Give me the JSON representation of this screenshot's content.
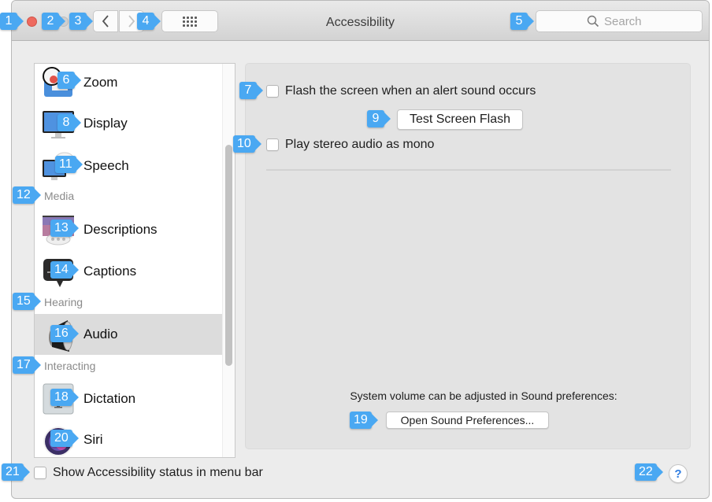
{
  "window": {
    "title": "Accessibility",
    "nav_back_glyph": "‹",
    "nav_forward_glyph": "›",
    "search": {
      "placeholder": "Search",
      "value": ""
    }
  },
  "sidebar": {
    "items": [
      {
        "label": "Zoom",
        "icon": "zoom-icon",
        "selected": false
      },
      {
        "label": "Display",
        "icon": "display-icon",
        "selected": false
      },
      {
        "label": "Speech",
        "icon": "speech-icon",
        "selected": false
      },
      {
        "label": "Descriptions",
        "icon": "descriptions-icon",
        "selected": false
      },
      {
        "label": "Captions",
        "icon": "captions-icon",
        "selected": false
      },
      {
        "label": "Audio",
        "icon": "speaker-icon",
        "selected": true
      },
      {
        "label": "Dictation",
        "icon": "dictation-icon",
        "selected": false
      },
      {
        "label": "Siri",
        "icon": "siri-icon",
        "selected": false
      }
    ],
    "sections": [
      "Media",
      "Hearing",
      "Interacting"
    ]
  },
  "audio_pane": {
    "flash_screen": {
      "label": "Flash the screen when an alert sound occurs",
      "checked": false
    },
    "test_flash_button": "Test Screen Flash",
    "stereo_mono": {
      "label": "Play stereo audio as mono",
      "checked": false
    },
    "volume_info": "System volume can be adjusted in Sound preferences:",
    "open_sound_button": "Open Sound Preferences..."
  },
  "footer": {
    "status_menu": {
      "label": "Show Accessibility status in menu bar",
      "checked": false
    },
    "help_glyph": "?"
  },
  "annotations": [
    "1",
    "2",
    "3",
    "4",
    "5",
    "6",
    "7",
    "8",
    "9",
    "10",
    "11",
    "12",
    "13",
    "14",
    "15",
    "16",
    "17",
    "18",
    "19",
    "20",
    "21",
    "22"
  ],
  "colors": {
    "accent": "#2f7de1",
    "badge": "#4aa8f2",
    "close": "#ee6a5f",
    "selection": "#dcdcdc"
  }
}
